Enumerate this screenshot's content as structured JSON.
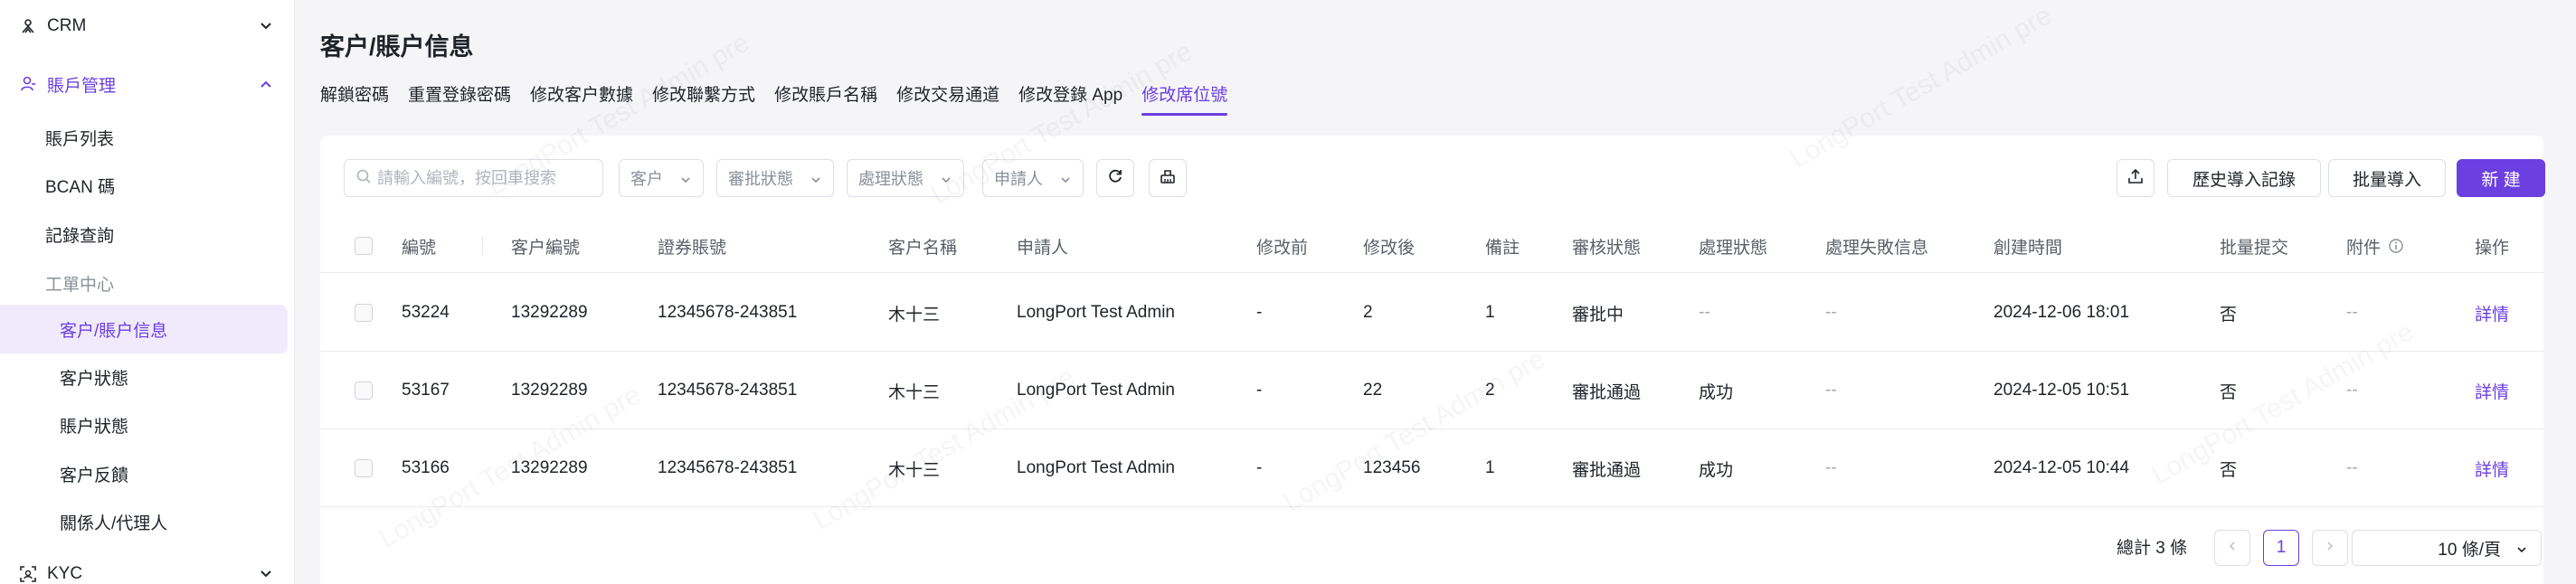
{
  "sidebar": {
    "crm_label": "CRM",
    "account_mgmt_label": "賬戶管理",
    "items": {
      "account_list": "賬戶列表",
      "bcan": "BCAN 碼",
      "records": "記錄查詢"
    },
    "work_center_label": "工單中心",
    "work_items": {
      "customer_info": "客户/賬户信息",
      "customer_status": "客户狀態",
      "account_status": "賬户狀態",
      "customer_feedback": "客户反饋",
      "related_person": "關係人/代理人"
    },
    "kyc_label": "KYC"
  },
  "page": {
    "title": "客户/賬户信息"
  },
  "tabs": [
    "解鎖密碼",
    "重置登錄密碼",
    "修改客户數據",
    "修改聯繫方式",
    "修改賬戶名稱",
    "修改交易通道",
    "修改登錄 App",
    "修改席位號"
  ],
  "active_tab": 7,
  "filters": {
    "search_placeholder": "請輸入編號，按回車搜索",
    "customer": "客户",
    "approval_status": "審批狀態",
    "process_status": "處理狀態",
    "applicant": "申請人"
  },
  "actions": {
    "history": "歷史導入記錄",
    "batch_import": "批量導入",
    "create": "新 建"
  },
  "table": {
    "headers": [
      "編號",
      "客户編號",
      "證券賬號",
      "客户名稱",
      "申請人",
      "修改前",
      "修改後",
      "備註",
      "審核狀態",
      "處理狀態",
      "處理失敗信息",
      "創建時間",
      "批量提交",
      "附件",
      "操作"
    ],
    "rows": [
      {
        "id": "53224",
        "customer_no": "13292289",
        "account": "12345678-243851",
        "name": "木十三",
        "applicant": "LongPort Test Admin",
        "before": "-",
        "after": "2",
        "remark": "1",
        "review": "審批中",
        "process": "--",
        "fail": "--",
        "created": "2024-12-06 18:01",
        "batch": "否",
        "attach": "--",
        "op": "詳情"
      },
      {
        "id": "53167",
        "customer_no": "13292289",
        "account": "12345678-243851",
        "name": "木十三",
        "applicant": "LongPort Test Admin",
        "before": "-",
        "after": "22",
        "remark": "2",
        "review": "審批通過",
        "process": "成功",
        "fail": "--",
        "created": "2024-12-05 10:51",
        "batch": "否",
        "attach": "--",
        "op": "詳情"
      },
      {
        "id": "53166",
        "customer_no": "13292289",
        "account": "12345678-243851",
        "name": "木十三",
        "applicant": "LongPort Test Admin",
        "before": "-",
        "after": "123456",
        "remark": "1",
        "review": "審批通過",
        "process": "成功",
        "fail": "--",
        "created": "2024-12-05 10:44",
        "batch": "否",
        "attach": "--",
        "op": "詳情"
      }
    ]
  },
  "pagination": {
    "total": "總計 3 條",
    "current_page": "1",
    "page_size": "10 條/頁"
  },
  "watermark": "LongPort Test Admin pre",
  "colors": {
    "accent": "#6b3fe0",
    "active_bg": "#f1eafd"
  }
}
